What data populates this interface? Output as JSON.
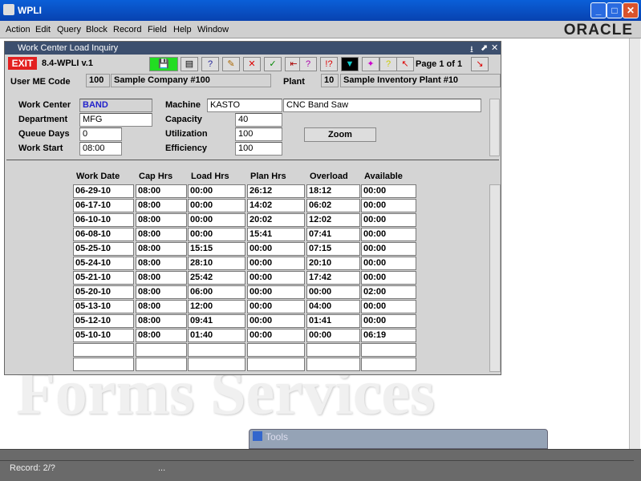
{
  "window": {
    "title": "WPLI",
    "brand": "ORACLE"
  },
  "menu": [
    "Action",
    "Edit",
    "Query",
    "Block",
    "Record",
    "Field",
    "Help",
    "Window"
  ],
  "inner": {
    "title": "Work Center Load Inquiry",
    "exit": "EXIT",
    "version": "8.4-WPLI v.1",
    "page": "Page 1 of 1"
  },
  "header": {
    "user_me_code_label": "User ME Code",
    "user_me_code": "100",
    "company": "Sample Company #100",
    "plant_label": "Plant",
    "plant": "10",
    "plant_name": "Sample Inventory Plant #10"
  },
  "form": {
    "work_center_label": "Work Center",
    "work_center": "BAND",
    "department_label": "Department",
    "department": "MFG",
    "queue_days_label": "Queue Days",
    "queue_days": "0",
    "work_start_label": "Work Start",
    "work_start": "08:00",
    "machine_label": "Machine",
    "machine": "KASTO",
    "machine_desc": "CNC Band Saw",
    "capacity_label": "Capacity",
    "capacity": "40",
    "utilization_label": "Utilization",
    "utilization": "100",
    "efficiency_label": "Efficiency",
    "efficiency": "100",
    "zoom": "Zoom"
  },
  "table": {
    "columns": [
      "Work Date",
      "Cap Hrs",
      "Load Hrs",
      "Plan Hrs",
      "Overload",
      "Available"
    ],
    "rows": [
      [
        "06-29-10",
        "08:00",
        "00:00",
        "26:12",
        "18:12",
        "00:00"
      ],
      [
        "06-17-10",
        "08:00",
        "00:00",
        "14:02",
        "06:02",
        "00:00"
      ],
      [
        "06-10-10",
        "08:00",
        "00:00",
        "20:02",
        "12:02",
        "00:00"
      ],
      [
        "06-08-10",
        "08:00",
        "00:00",
        "15:41",
        "07:41",
        "00:00"
      ],
      [
        "05-25-10",
        "08:00",
        "15:15",
        "00:00",
        "07:15",
        "00:00"
      ],
      [
        "05-24-10",
        "08:00",
        "28:10",
        "00:00",
        "20:10",
        "00:00"
      ],
      [
        "05-21-10",
        "08:00",
        "25:42",
        "00:00",
        "17:42",
        "00:00"
      ],
      [
        "05-20-10",
        "08:00",
        "06:00",
        "00:00",
        "00:00",
        "02:00"
      ],
      [
        "05-13-10",
        "08:00",
        "12:00",
        "00:00",
        "04:00",
        "00:00"
      ],
      [
        "05-12-10",
        "08:00",
        "09:41",
        "00:00",
        "01:41",
        "00:00"
      ],
      [
        "05-10-10",
        "08:00",
        "01:40",
        "00:00",
        "00:00",
        "06:19"
      ],
      [
        "",
        "",
        "",
        "",
        "",
        ""
      ],
      [
        "",
        "",
        "",
        "",
        "",
        ""
      ]
    ]
  },
  "tools": {
    "title": "Tools"
  },
  "status": {
    "record": "Record: 2/?",
    "ellipsis": "..."
  },
  "watermark": "Forms Services"
}
